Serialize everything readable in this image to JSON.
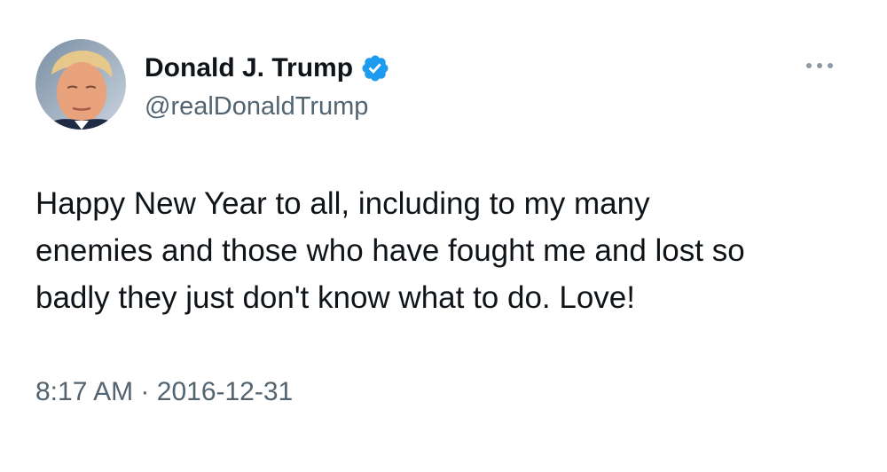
{
  "author": {
    "name": "Donald J. Trump",
    "handle": "@realDonaldTrump",
    "verified": true,
    "avatar_icon": "profile-photo"
  },
  "tweet": {
    "text": "Happy New Year to all, including to my many\nenemies and those who have fought me and lost so\nbadly they just don't know what to do. Love!",
    "time": "8:17 AM",
    "separator": "·",
    "date": "2016-12-31"
  },
  "icons": {
    "verified": "verified-badge-icon",
    "more": "more-options-icon"
  },
  "colors": {
    "text_primary": "#0f1419",
    "text_secondary": "#536471",
    "verified_blue": "#1d9bf0",
    "background": "#ffffff"
  }
}
